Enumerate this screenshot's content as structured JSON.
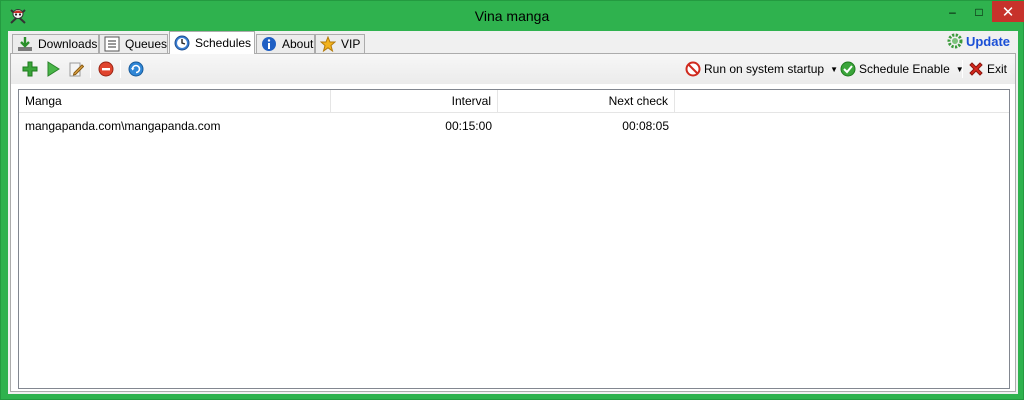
{
  "window": {
    "title": "Vina manga",
    "app_icon": "skull-crossbones-icon",
    "controls": {
      "minimize": "–",
      "maximize": "□",
      "close": "✕"
    }
  },
  "tabs": [
    {
      "label": "Downloads",
      "icon": "download-arrow-icon",
      "active": false
    },
    {
      "label": "Queues",
      "icon": "list-icon",
      "active": false
    },
    {
      "label": "Schedules",
      "icon": "clock-icon",
      "active": true
    },
    {
      "label": "About",
      "icon": "info-icon",
      "active": false
    },
    {
      "label": "VIP",
      "icon": "star-icon",
      "active": false
    }
  ],
  "update_link": {
    "label": "Update",
    "icon": "gear-icon"
  },
  "toolbar": {
    "buttons": [
      "add-icon",
      "play-icon",
      "edit-icon",
      "stop-icon",
      "refresh-icon"
    ],
    "run_on_startup": {
      "label": "Run on system startup",
      "icon": "prohibited-icon"
    },
    "schedule_enable": {
      "label": "Schedule Enable",
      "icon": "check-circle-icon"
    },
    "exit": {
      "label": "Exit",
      "icon": "red-x-icon"
    }
  },
  "list": {
    "columns": [
      "Manga",
      "Interval",
      "Next check"
    ],
    "rows": [
      {
        "manga": "mangapanda.com\\mangapanda.com",
        "interval": "00:15:00",
        "next_check": "00:08:05"
      }
    ]
  },
  "colors": {
    "frame": "#2fb24e",
    "close_button": "#c7322b",
    "update_link": "#1a4fd6"
  }
}
